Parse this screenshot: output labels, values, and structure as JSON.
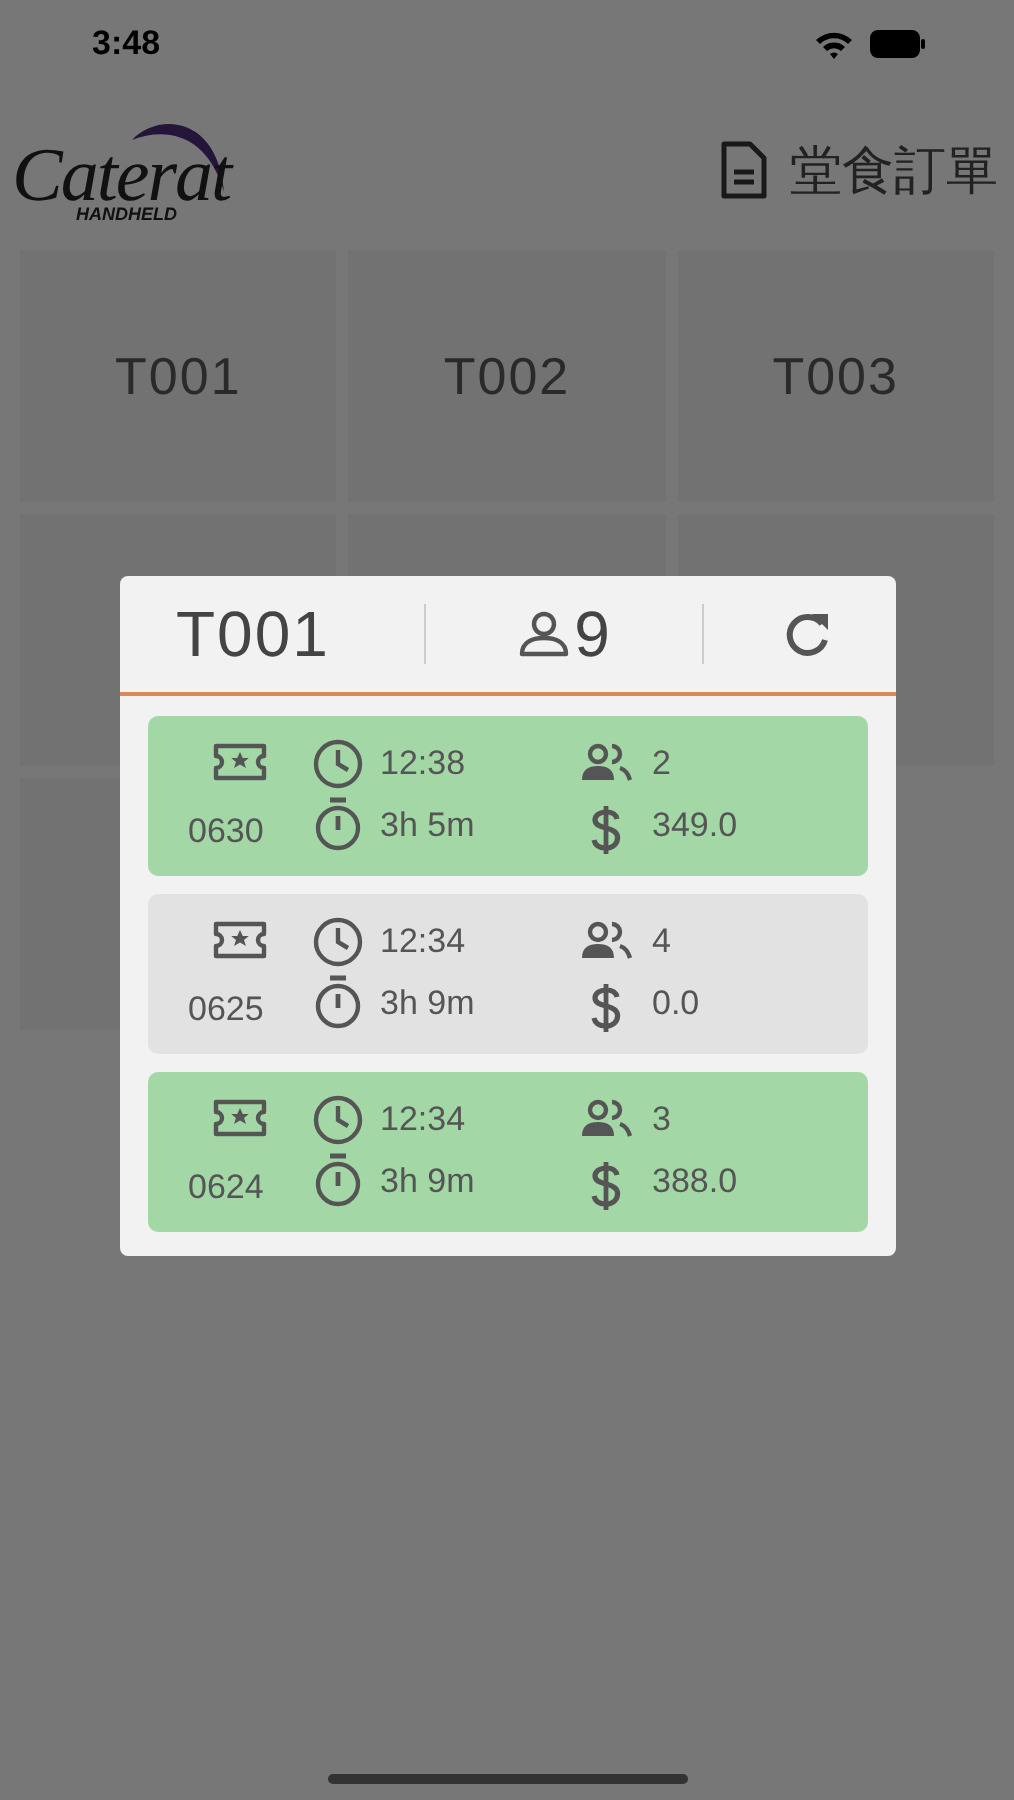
{
  "status_bar": {
    "time": "3:48"
  },
  "header": {
    "logo": {
      "name": "Caterat",
      "sub": "HANDHELD"
    },
    "title": "堂食訂單"
  },
  "tables": [
    {
      "label": "T001"
    },
    {
      "label": "T002"
    },
    {
      "label": "T003"
    }
  ],
  "popup": {
    "table": "T001",
    "guests": "9",
    "orders": [
      {
        "number": "0630",
        "time": "12:38",
        "duration": "3h 5m",
        "people": "2",
        "amount": "349.0",
        "color": "#a3d8a6"
      },
      {
        "number": "0625",
        "time": "12:34",
        "duration": "3h 9m",
        "people": "4",
        "amount": "0.0",
        "color": "#e2e2e2"
      },
      {
        "number": "0624",
        "time": "12:34",
        "duration": "3h 9m",
        "people": "3",
        "amount": "388.0",
        "color": "#a3d8a6"
      }
    ]
  }
}
